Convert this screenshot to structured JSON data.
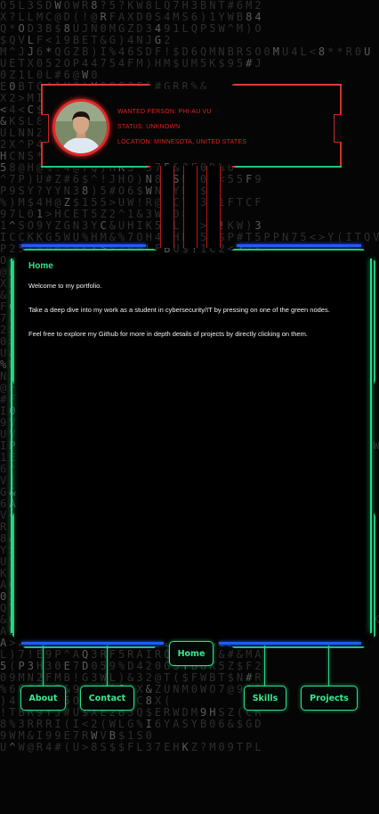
{
  "profile": {
    "wanted": "WANTED PERSON: PHI-AU VU",
    "status": "STATUS: UNKNOWN",
    "location": "LOCATION: MINNESOTA, UNITED STATES"
  },
  "main": {
    "title": "Home",
    "paragraphs": [
      "Welcome to my portfolio.",
      "Take a deep dive into my work as a student in cybersecurity/IT by pressing on one of the green nodes.",
      "Feel free to explore my Github for more in depth details of projects by directly clicking on them."
    ]
  },
  "nav": {
    "home": "Home",
    "about": "About",
    "contact": "Contact",
    "skills": "Skills",
    "projects": "Projects"
  },
  "colors": {
    "accent_green": "#2ee08c",
    "accent_red": "#e02020",
    "accent_blue": "#1f5cff",
    "background": "#050505"
  }
}
